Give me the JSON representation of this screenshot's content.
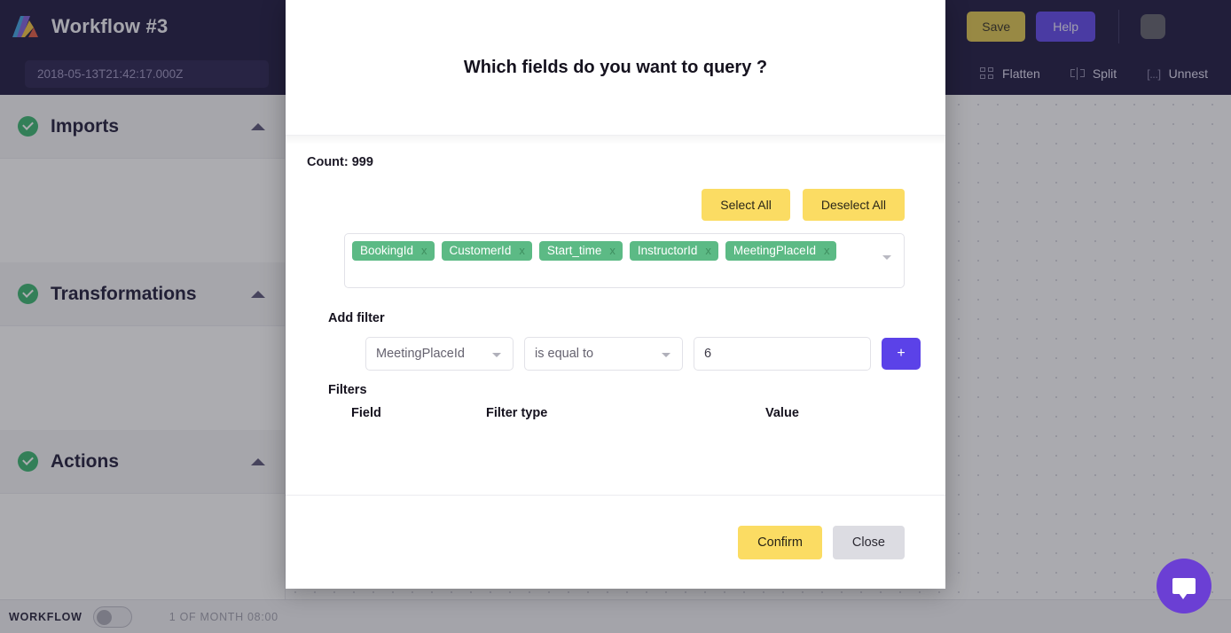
{
  "topbar": {
    "app_title": "Workflow #3",
    "logo_icon": "adverity-triangle-logo",
    "save_label": "Save",
    "help_label": "Help",
    "avatar_icon": "avatar-placeholder",
    "accent_purple": "#5b42e8",
    "accent_yellow": "#ddc44a",
    "bg": "#16113a"
  },
  "secondrow": {
    "timestamp": "2018-05-13T21:42:17.000Z",
    "tools": [
      {
        "label": "Flatten",
        "icon": "flatten-icon"
      },
      {
        "label": "Split",
        "icon": "split-icon"
      },
      {
        "label": "Unnest",
        "icon": "unnest-icon",
        "glyph": "[...]"
      }
    ]
  },
  "sidebar": {
    "sections": [
      {
        "title": "Imports",
        "status_icon": "check-circle-icon",
        "caret": "chevron-up-icon"
      },
      {
        "title": "Transformations",
        "status_icon": "check-circle-icon",
        "caret": "chevron-up-icon"
      },
      {
        "title": "Actions",
        "status_icon": "check-circle-icon",
        "caret": "chevron-up-icon"
      }
    ],
    "status_color": "#34b36b"
  },
  "canvas": {
    "search_placeholder": "",
    "search_icon": "search-icon"
  },
  "bottombar": {
    "label": "WORKFLOW",
    "toggle_state": "off",
    "schedule": "1 OF MONTH 08:00"
  },
  "chat": {
    "icon": "chat-bubble-icon",
    "color": "#6b3fd4"
  },
  "modal": {
    "title": "Which fields do you want to query ?",
    "count_label": "Count: 999",
    "select_all_label": "Select All",
    "deselect_all_label": "Deselect All",
    "chips_caret_icon": "chevron-down-icon",
    "chip_color": "#5cba85",
    "selected_fields": [
      {
        "label": "BookingId",
        "remove_icon": "close-icon",
        "remove_glyph": "x"
      },
      {
        "label": "CustomerId",
        "remove_icon": "close-icon",
        "remove_glyph": "x"
      },
      {
        "label": "Start_time",
        "remove_icon": "close-icon",
        "remove_glyph": "x"
      },
      {
        "label": "InstructorId",
        "remove_icon": "close-icon",
        "remove_glyph": "x"
      },
      {
        "label": "MeetingPlaceId",
        "remove_icon": "close-icon",
        "remove_glyph": "x"
      }
    ],
    "add_filter": {
      "heading": "Add filter",
      "field_value": "MeetingPlaceId",
      "type_value": "is equal to",
      "value_value": "6",
      "add_glyph": "+",
      "caret_icon": "chevron-down-icon"
    },
    "filters": {
      "heading": "Filters",
      "columns": [
        "Field",
        "Filter type",
        "Value"
      ],
      "rows": []
    },
    "confirm_label": "Confirm",
    "close_label": "Close"
  }
}
